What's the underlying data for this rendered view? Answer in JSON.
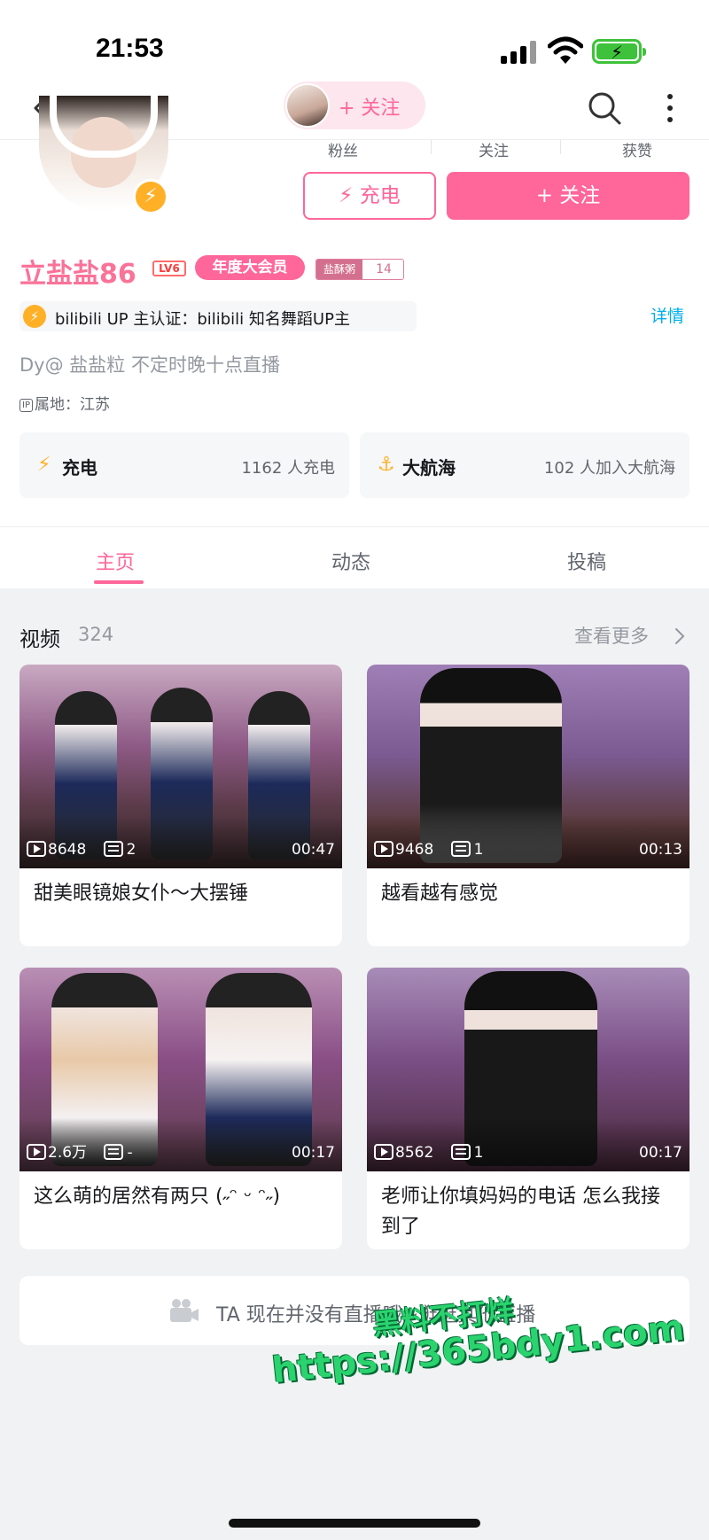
{
  "status_bar": {
    "time": "21:53"
  },
  "nav": {
    "follow_label": "+ 关注"
  },
  "stats": [
    {
      "label": "粉丝"
    },
    {
      "label": "关注"
    },
    {
      "label": "获赞"
    }
  ],
  "actions": {
    "charge_label": "充电",
    "follow_label": "+ 关注"
  },
  "profile": {
    "name": "立盐盐86",
    "level": "LV6",
    "vip_badge": "年度大会员",
    "fan_medal_name": "盐酥粥",
    "fan_medal_level": "14",
    "certification": "bilibili UP 主认证：bilibili 知名舞蹈UP主",
    "detail_link": "详情",
    "bio": "Dy@ 盐盐粒    不定时晚十点直播",
    "ip_tag": "IP",
    "ip_location": "属地：江苏"
  },
  "cards": [
    {
      "title": "充电",
      "count": "1162 人充电",
      "icon": "lightning-icon"
    },
    {
      "title": "大航海",
      "count": "102 人加入大航海",
      "icon": "anchor-icon"
    }
  ],
  "tabs": [
    {
      "label": "主页",
      "active": true
    },
    {
      "label": "动态",
      "active": false
    },
    {
      "label": "投稿",
      "active": false
    }
  ],
  "videos_section": {
    "title": "视频",
    "count": "324",
    "see_more": "查看更多"
  },
  "videos": [
    {
      "plays": "8648",
      "danmaku": "2",
      "duration": "00:47",
      "title": "甜美眼镜娘女仆～大摆锤"
    },
    {
      "plays": "9468",
      "danmaku": "1",
      "duration": "00:13",
      "title": "越看越有感觉"
    },
    {
      "plays": "2.6万",
      "danmaku": "-",
      "duration": "00:17",
      "title": "这么萌的居然有两只 (˶ᵔ ᵕ ᵔ˶)"
    },
    {
      "plays": "8562",
      "danmaku": "1",
      "duration": "00:17",
      "title": "老师让你填妈妈的电话 怎么我接到了"
    }
  ],
  "live": {
    "text": "TA 现在并没有直播哦~逛逛其他直播"
  },
  "watermark": {
    "line1": "黑料不打烊",
    "line2": "https://365bdy1.com"
  },
  "colors": {
    "accent": "#ff6699",
    "link": "#00aeec",
    "gold": "#ffb027"
  }
}
